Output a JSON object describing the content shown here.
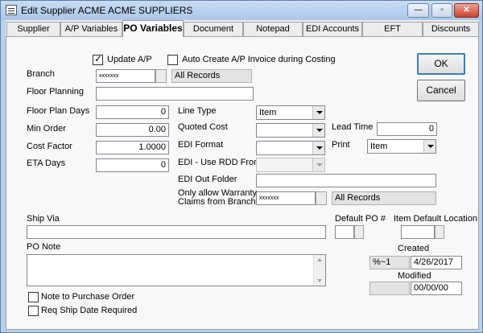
{
  "window": {
    "title": "Edit Supplier ACME ACME SUPPLIERS"
  },
  "tabs": [
    "Supplier",
    "A/P Variables",
    "PO Variables",
    "Document",
    "Notepad",
    "EDI Accounts",
    "EFT",
    "Discounts"
  ],
  "form": {
    "update_ap_label": "Update A/P",
    "auto_create_label": "Auto Create A/P Invoice during Costing",
    "branch_label": "Branch",
    "branch_code": "xxxxxxx",
    "branch_desc": "All Records",
    "floor_planning_label": "Floor Planning",
    "floor_planning_value": "",
    "floor_plan_days_label": "Floor Plan Days",
    "floor_plan_days_value": "0",
    "min_order_label": "Min Order",
    "min_order_value": "0.00",
    "cost_factor_label": "Cost Factor",
    "cost_factor_value": "1.0000",
    "eta_days_label": "ETA Days",
    "eta_days_value": "0",
    "line_type_label": "Line Type",
    "line_type_value": "Item",
    "quoted_cost_label": "Quoted Cost",
    "quoted_cost_value": "",
    "edi_format_label": "EDI Format",
    "edi_format_value": "",
    "edi_rdd_label": "EDI - Use RDD From",
    "edi_rdd_value": "",
    "edi_out_folder_label": "EDI Out Folder",
    "edi_out_folder_value": "",
    "warranty_label_1": "Only allow Warranty",
    "warranty_label_2": "Claims from Branch",
    "warranty_branch_code": "xxxxxxx",
    "warranty_branch_desc": "All Records",
    "lead_time_label": "Lead Time",
    "lead_time_value": "0",
    "print_label": "Print",
    "print_value": "Item",
    "ship_via_label": "Ship Via",
    "ship_via_value": "",
    "default_po_label": "Default PO #",
    "item_default_location_label": "Item Default Location",
    "po_note_label": "PO Note",
    "created_label": "Created",
    "created_user": "%~1",
    "created_date": "4/26/2017",
    "modified_label": "Modified",
    "modified_user": "",
    "modified_date": "00/00/00",
    "note_to_po_label": "Note to Purchase Order",
    "req_ship_date_label": "Req Ship Date Required"
  },
  "buttons": {
    "ok": "OK",
    "cancel": "Cancel",
    "minimize": "—",
    "maximize": "▫",
    "close": "✕"
  }
}
